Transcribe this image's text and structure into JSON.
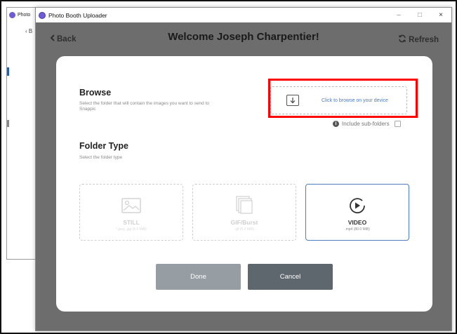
{
  "background_window": {
    "title": "Photo",
    "back_label": "B"
  },
  "window": {
    "title": "Photo Booth Uploader",
    "controls": {
      "minimize": "–",
      "maximize": "□",
      "close": "×"
    }
  },
  "header": {
    "back_label": "Back",
    "title": "Welcome Joseph Charpentier!",
    "refresh_label": "Refresh"
  },
  "browse": {
    "heading": "Browse",
    "description": "Select the folder that will contain the images you want to send to Snappic",
    "drop_text": "Click to browse on your device",
    "include_subfolders_label": "Include sub-folders",
    "include_subfolders_checked": false
  },
  "folder_type": {
    "heading": "Folder Type",
    "description": "Select the folder type",
    "options": [
      {
        "label": "STILL",
        "sub": "*.jpeg .jpg (5.0 MiB)",
        "icon": "image-icon",
        "selected": false
      },
      {
        "label": "GIF/Burst",
        "sub": ".gif (5.0 MiB)",
        "icon": "stack-icon",
        "selected": false
      },
      {
        "label": "VIDEO",
        "sub": ".mp4 (80.0 MiB)",
        "icon": "play-icon",
        "selected": true
      }
    ]
  },
  "actions": {
    "done_label": "Done",
    "cancel_label": "Cancel"
  },
  "colors": {
    "accent": "#4d7fbf",
    "highlight": "#ff0000",
    "overlay": "#6d6d6d",
    "done_button": "#969da3",
    "cancel_button": "#5f676e"
  }
}
